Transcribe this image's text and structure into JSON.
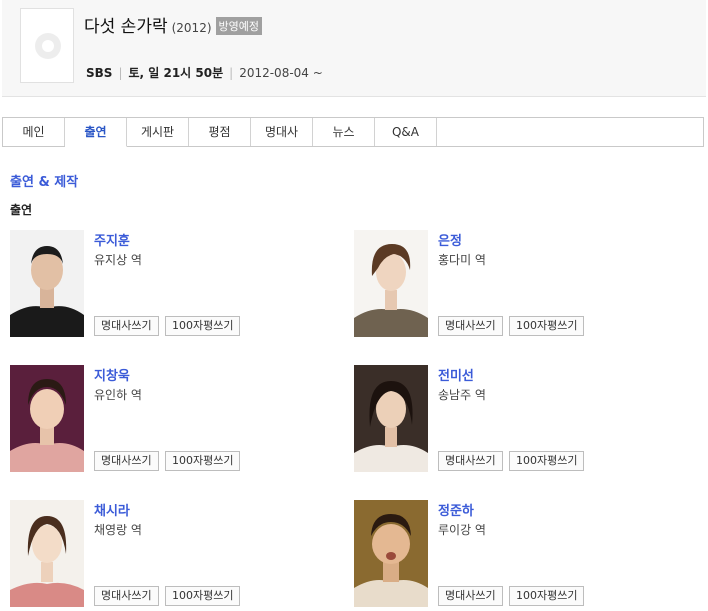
{
  "header": {
    "title": "다섯 손가락",
    "year": "(2012)",
    "badge": "방영예정",
    "channel": "SBS",
    "schedule": "토, 일 21시 50분",
    "date": "2012-08-04 ~"
  },
  "tabs": [
    {
      "label": "메인"
    },
    {
      "label": "출연"
    },
    {
      "label": "게시판"
    },
    {
      "label": "평점"
    },
    {
      "label": "명대사"
    },
    {
      "label": "뉴스"
    },
    {
      "label": "Q&A"
    }
  ],
  "section": {
    "title": "출연 & 제작",
    "subtitle": "출연"
  },
  "buttons": {
    "quote": "명대사쓰기",
    "review": "100자평쓰기"
  },
  "cast": [
    {
      "name": "주지훈",
      "role": "유지상 역"
    },
    {
      "name": "은정",
      "role": "홍다미 역"
    },
    {
      "name": "지창욱",
      "role": "유인하 역"
    },
    {
      "name": "전미선",
      "role": "송남주 역"
    },
    {
      "name": "채시라",
      "role": "채영랑 역"
    },
    {
      "name": "정준하",
      "role": "루이강 역"
    }
  ],
  "colors": {
    "accent": "#3b5bd8",
    "badge": "#a0a0a0"
  }
}
